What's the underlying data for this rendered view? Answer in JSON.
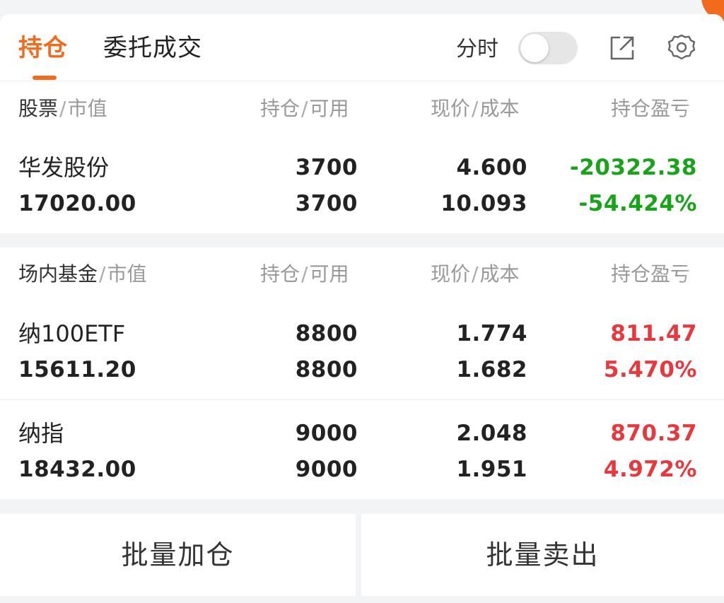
{
  "header": {
    "tabs": [
      {
        "label": "持仓",
        "active": true
      },
      {
        "label": "委托成交",
        "active": false
      }
    ],
    "toggle_label": "分时",
    "toggle_on": false,
    "share_icon": "share-external-icon",
    "settings_icon": "gear-icon",
    "accent_color": "#f26b1d"
  },
  "stocks": {
    "header": {
      "name": "股票",
      "name_sub": "市值",
      "qty": "持仓",
      "qty_sub": "可用",
      "price": "现价",
      "price_sub": "成本",
      "pnl": "持仓盈亏"
    },
    "rows": [
      {
        "name": "华发股份",
        "market_value": "17020.00",
        "position": "3700",
        "available": "3700",
        "price": "4.600",
        "cost": "10.093",
        "pnl": "-20322.38",
        "pnl_pct": "-54.424%",
        "trend": "loss"
      }
    ]
  },
  "funds": {
    "header": {
      "name": "场内基金",
      "name_sub": "市值",
      "qty": "持仓",
      "qty_sub": "可用",
      "price": "现价",
      "price_sub": "成本",
      "pnl": "持仓盈亏"
    },
    "rows": [
      {
        "name": "纳100ETF",
        "market_value": "15611.20",
        "position": "8800",
        "available": "8800",
        "price": "1.774",
        "cost": "1.682",
        "pnl": "811.47",
        "pnl_pct": "5.470%",
        "trend": "gain"
      },
      {
        "name": "纳指",
        "market_value": "18432.00",
        "position": "9000",
        "available": "9000",
        "price": "2.048",
        "cost": "1.951",
        "pnl": "870.37",
        "pnl_pct": "4.972%",
        "trend": "gain"
      }
    ]
  },
  "actions": {
    "batch_add": "批量加仓",
    "batch_sell": "批量卖出"
  },
  "colors": {
    "gain": "#e8383d",
    "loss": "#18a418"
  }
}
